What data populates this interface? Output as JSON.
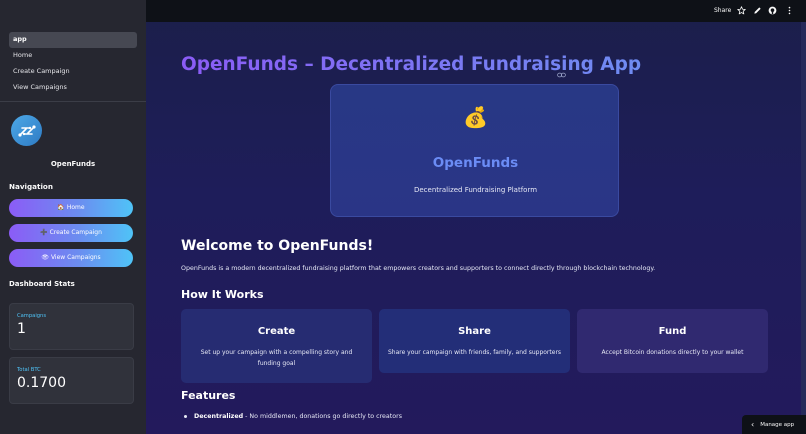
{
  "sidebar": {
    "pages": [
      {
        "label": "app",
        "active": true
      },
      {
        "label": "Home",
        "active": false
      },
      {
        "label": "Create Campaign",
        "active": false
      },
      {
        "label": "View Campaigns",
        "active": false
      }
    ],
    "brand": "OpenFunds",
    "nav_heading": "Navigation",
    "nav_buttons": [
      {
        "icon": "🏠",
        "label": "Home"
      },
      {
        "icon": "➕",
        "label": "Create Campaign"
      },
      {
        "icon": "👁",
        "label": "View Campaigns"
      }
    ],
    "stats_heading": "Dashboard Stats",
    "stats": [
      {
        "label": "Campaigns",
        "value": "1"
      },
      {
        "label": "Total BTC",
        "value": "0.1700"
      }
    ]
  },
  "header": {
    "share_label": "Share"
  },
  "main": {
    "title": "OpenFunds – Decentralized Fundraising App",
    "hero": {
      "emoji": "💰",
      "title": "OpenFunds",
      "subtitle": "Decentralized Fundraising Platform"
    },
    "welcome": "Welcome to OpenFunds!",
    "intro": "OpenFunds is a modern decentralized fundraising platform that empowers creators and supporters to connect directly through blockchain technology.",
    "how_heading": "How It Works",
    "cards": [
      {
        "title": "Create",
        "desc": "Set up your campaign with a compelling story and funding goal"
      },
      {
        "title": "Share",
        "desc": "Share your campaign with friends, family, and supporters"
      },
      {
        "title": "Fund",
        "desc": "Accept Bitcoin donations directly to your wallet"
      }
    ],
    "features_heading": "Features",
    "features": [
      {
        "bold": "Decentralized",
        "text": " - No middlemen, donations go directly to creators"
      }
    ]
  },
  "manage_label": "Manage app",
  "colors": {
    "accent_purple": "#8b5cf6",
    "accent_blue": "#4fc3f7",
    "hero_title": "#6b8cf5",
    "sidebar_bg": "#262730",
    "main_bg": "#1e1d5a"
  }
}
